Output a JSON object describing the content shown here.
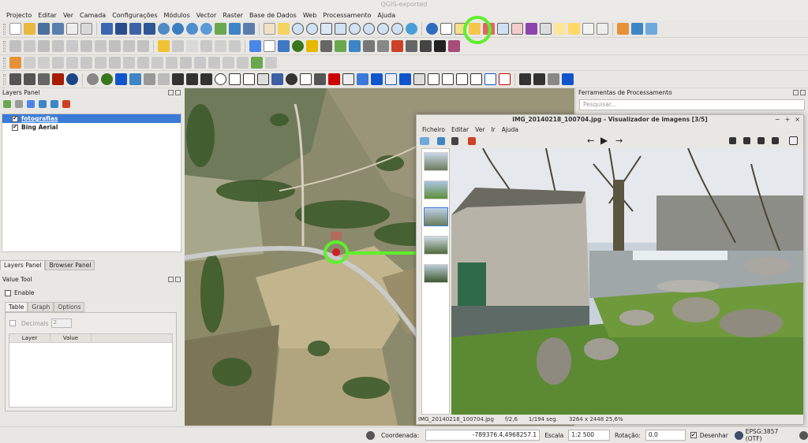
{
  "window": {
    "title": "QGIS-exported"
  },
  "menu": [
    "Projecto",
    "Editar",
    "Ver",
    "Camada",
    "Configurações",
    "Módulos",
    "Vector",
    "Raster",
    "Base de Dados",
    "Web",
    "Processamento",
    "Ajuda"
  ],
  "layers_panel": {
    "title": "Layers Panel",
    "layers": [
      {
        "name": "fotografias",
        "checked": true,
        "selected": true
      },
      {
        "name": "Bing Aerial",
        "checked": true,
        "selected": false
      }
    ],
    "tabs": [
      "Layers Panel",
      "Browser Panel"
    ]
  },
  "value_tool": {
    "title": "Value Tool",
    "enable_label": "Enable",
    "tabs": [
      "Table",
      "Graph",
      "Options"
    ],
    "decimals_label": "Decimals",
    "decimals_value": "2",
    "columns": [
      "Layer",
      "Value"
    ]
  },
  "processing": {
    "title": "Ferramentas de Processamento",
    "search_placeholder": "Pesquisar..."
  },
  "viewer": {
    "title": "IMG_20140218_100704.jpg - Visualizador de imagens [3/5]",
    "menu": [
      "Ficheiro",
      "Editar",
      "Ver",
      "Ir",
      "Ajuda"
    ],
    "status": {
      "filename": "IMG_20140218_100704.jpg",
      "aperture": "f/2,6",
      "exposure": "1/194 seg.",
      "dims": "3264 x 2448 25,6%"
    }
  },
  "statusbar": {
    "coord_label": "Coordenada:",
    "coord_value": "-789376.4,4968257.1",
    "scale_label": "Escala",
    "scale_value": "1:2 500",
    "rotation_label": "Rotação:",
    "rotation_value": "0,0",
    "render_label": "Desenhar",
    "crs": "EPSG:3857 (OTF)"
  },
  "colors": {
    "highlight": "#5ef02b",
    "selection": "#3b7bd6"
  }
}
